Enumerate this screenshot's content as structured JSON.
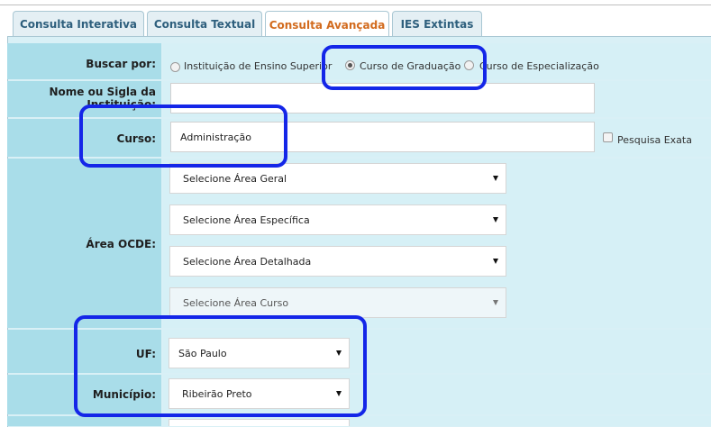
{
  "tabs": [
    {
      "label": "Consulta Interativa",
      "active": false
    },
    {
      "label": "Consulta Textual",
      "active": false
    },
    {
      "label": "Consulta Avançada",
      "active": true
    },
    {
      "label": "IES Extintas",
      "active": false
    }
  ],
  "form": {
    "buscar_por": {
      "label": "Buscar por:",
      "options": [
        {
          "label": "Instituição de Ensino Superior",
          "checked": false
        },
        {
          "label": "Curso de Graduação",
          "checked": true
        },
        {
          "label": "Curso de Especialização",
          "checked": false
        }
      ]
    },
    "nome_sigla": {
      "label": "Nome ou Sigla da Instituição:",
      "value": ""
    },
    "curso": {
      "label": "Curso:",
      "value": "Administração",
      "exact_label": "Pesquisa Exata",
      "exact_checked": false
    },
    "area_ocde": {
      "label": "Área OCDE:",
      "selects": [
        {
          "value": "Selecione Área Geral",
          "disabled": false
        },
        {
          "value": "Selecione Área Específica",
          "disabled": false
        },
        {
          "value": "Selecione Área Detalhada",
          "disabled": false
        },
        {
          "value": "Selecione Área Curso",
          "disabled": true
        }
      ]
    },
    "uf": {
      "label": "UF:",
      "value": "São Paulo"
    },
    "municipio": {
      "label": "Município:",
      "value": "Ribeirão Preto"
    }
  },
  "colors": {
    "highlight": "#1426e8",
    "active_tab_text": "#d26b1e",
    "tab_text": "#2e5f7d",
    "label_column": "#a9dde9",
    "field_column": "#d6f0f6"
  }
}
